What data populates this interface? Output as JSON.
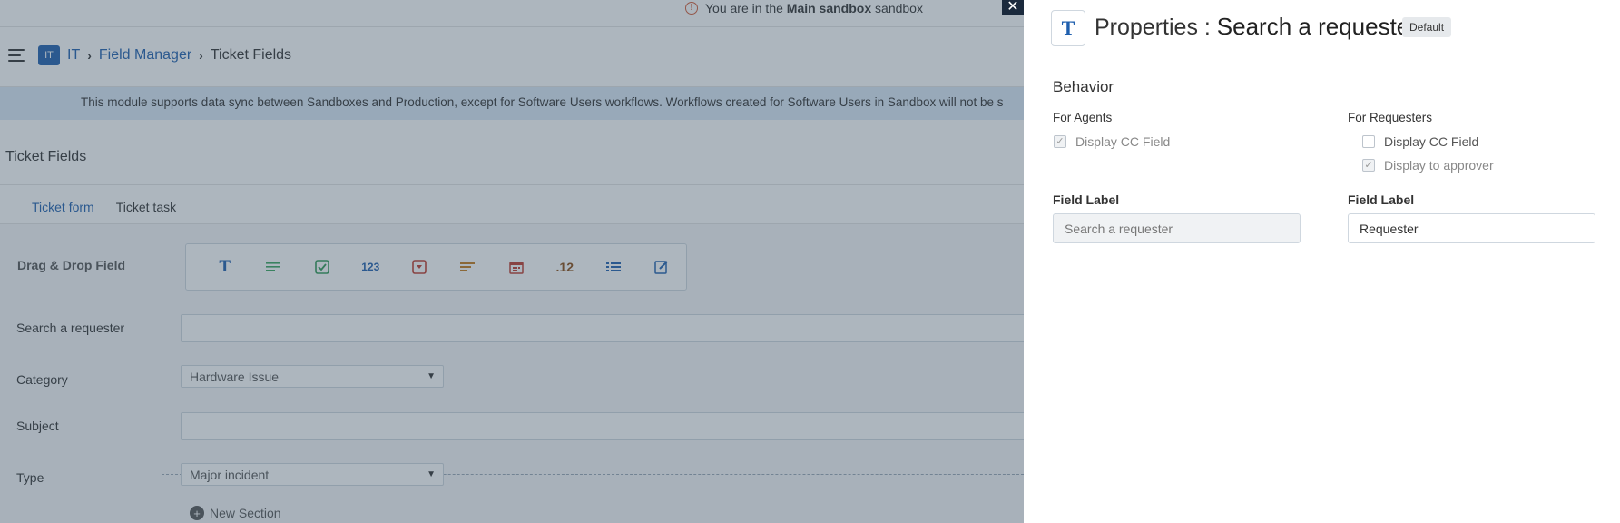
{
  "banner": {
    "prefix": "You are in the",
    "sandbox_name": "Main sandbox",
    "suffix": "sandbox"
  },
  "breadcrumb": {
    "badge": "IT",
    "items": [
      "IT",
      "Field Manager"
    ],
    "current": "Ticket Fields"
  },
  "info_bar": {
    "text": "This module supports data sync between Sandboxes and Production, except for Software Users workflows. Workflows created for Software Users in Sandbox will not be s"
  },
  "page": {
    "title": "Ticket Fields"
  },
  "tabs": [
    {
      "label": "Ticket form",
      "active": true
    },
    {
      "label": "Ticket task",
      "active": false
    }
  ],
  "palette": {
    "label": "Drag & Drop Field",
    "icons": [
      "text-icon",
      "paragraph-icon",
      "checkbox-icon",
      "number-icon",
      "dropdown-icon",
      "dependent-field-icon",
      "date-icon",
      "decimal-icon",
      "multi-select-icon",
      "lookup-icon"
    ],
    "number_glyph": "123",
    "decimal_glyph": ".12"
  },
  "form_fields": [
    {
      "label": "Search a requester",
      "type": "text",
      "value": ""
    },
    {
      "label": "Category",
      "type": "select",
      "value": "Hardware Issue"
    },
    {
      "label": "Subject",
      "type": "text",
      "value": ""
    },
    {
      "label": "Type",
      "type": "select",
      "value": "Major incident"
    }
  ],
  "new_section": {
    "label": "New Section"
  },
  "panel": {
    "icon_glyph": "T",
    "title_prefix": "Properties :",
    "field_name": "Search a requester",
    "badge": "Default",
    "behavior_heading": "Behavior",
    "agents": {
      "heading": "For Agents",
      "checkboxes": [
        {
          "label": "Display CC Field",
          "checked": true,
          "disabled": true
        }
      ],
      "field_label_heading": "Field Label",
      "field_label_value": "Search a requester"
    },
    "requesters": {
      "heading": "For Requesters",
      "checkboxes": [
        {
          "label": "Display CC Field",
          "checked": false,
          "disabled": false
        },
        {
          "label": "Display to approver",
          "checked": true,
          "disabled": true
        }
      ],
      "field_label_heading": "Field Label",
      "field_label_value": "Requester"
    }
  },
  "colors": {
    "accent": "#1f5fae",
    "overlay": "#3c5064",
    "warning": "#d35a36"
  }
}
